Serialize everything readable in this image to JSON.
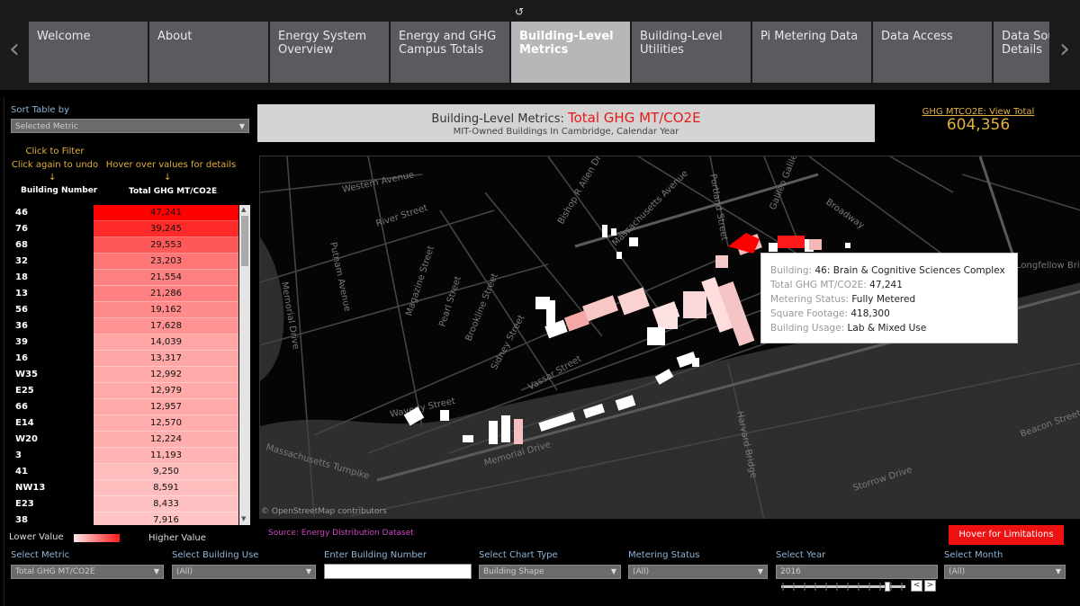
{
  "nav": {
    "tabs": [
      {
        "label": "Welcome",
        "active": false
      },
      {
        "label": "About",
        "active": false
      },
      {
        "label": "Energy System Overview",
        "active": false
      },
      {
        "label": "Energy and GHG Campus Totals",
        "active": false
      },
      {
        "label": "Building-Level Metrics",
        "active": true
      },
      {
        "label": "Building-Level Utilities",
        "active": false
      },
      {
        "label": "Pi Metering Data",
        "active": false
      },
      {
        "label": "Data Access",
        "active": false
      },
      {
        "label": "Data Source Details",
        "active": false
      }
    ],
    "reload_icon": "↺",
    "prev_icon": "‹",
    "next_icon": "›"
  },
  "sort": {
    "label": "Sort Table by",
    "value": "Selected Metric"
  },
  "hints": {
    "filter_line1": "Click to Filter",
    "filter_line2": "Click again to undo",
    "hover": "Hover over values for details",
    "arrow": "↓"
  },
  "table": {
    "col_building": "Building Number",
    "col_metric": "Total GHG MT/CO2E",
    "rows": [
      {
        "building": "46",
        "value": "47,241",
        "level": 1.0
      },
      {
        "building": "76",
        "value": "39,245",
        "level": 0.82
      },
      {
        "building": "68",
        "value": "29,553",
        "level": 0.62
      },
      {
        "building": "32",
        "value": "23,203",
        "level": 0.49
      },
      {
        "building": "18",
        "value": "21,554",
        "level": 0.45
      },
      {
        "building": "13",
        "value": "21,286",
        "level": 0.45
      },
      {
        "building": "56",
        "value": "19,162",
        "level": 0.4
      },
      {
        "building": "36",
        "value": "17,628",
        "level": 0.37
      },
      {
        "building": "39",
        "value": "14,039",
        "level": 0.29
      },
      {
        "building": "16",
        "value": "13,317",
        "level": 0.28
      },
      {
        "building": "W35",
        "value": "12,992",
        "level": 0.27
      },
      {
        "building": "E25",
        "value": "12,979",
        "level": 0.27
      },
      {
        "building": "66",
        "value": "12,957",
        "level": 0.27
      },
      {
        "building": "E14",
        "value": "12,570",
        "level": 0.26
      },
      {
        "building": "W20",
        "value": "12,224",
        "level": 0.25
      },
      {
        "building": "3",
        "value": "11,193",
        "level": 0.23
      },
      {
        "building": "41",
        "value": "9,250",
        "level": 0.19
      },
      {
        "building": "NW13",
        "value": "8,591",
        "level": 0.18
      },
      {
        "building": "E23",
        "value": "8,433",
        "level": 0.17
      },
      {
        "building": "38",
        "value": "7,916",
        "level": 0.16
      }
    ]
  },
  "legend": {
    "low": "Lower Value",
    "high": "Higher Value"
  },
  "title": {
    "prefix": "Building-Level Metrics: ",
    "metric": "Total GHG MT/CO2E",
    "subtitle": "MIT-Owned Buildings In Cambridge, Calendar Year"
  },
  "ghg_summary": {
    "link": "GHG MTCO2E: View Total",
    "total": "604,356"
  },
  "map": {
    "attribution": "© OpenStreetMap contributors",
    "streets": [
      {
        "name": "Western Avenue"
      },
      {
        "name": "River Street"
      },
      {
        "name": "Putnam Avenue"
      },
      {
        "name": "Magazine Street"
      },
      {
        "name": "Pearl Street"
      },
      {
        "name": "Brookline Street"
      },
      {
        "name": "Sidney Street"
      },
      {
        "name": "Memorial Drive"
      },
      {
        "name": "Waverly Street"
      },
      {
        "name": "Vassar Street"
      },
      {
        "name": "Massachusetts Avenue"
      },
      {
        "name": "Portland Street"
      },
      {
        "name": "Broadway"
      },
      {
        "name": "Galileo Galilei"
      },
      {
        "name": "Harvard Bridge"
      },
      {
        "name": "Storrow Drive"
      },
      {
        "name": "Beacon Street"
      },
      {
        "name": "Bishop R Allen Drive"
      },
      {
        "name": "Massachusetts Turnpike"
      },
      {
        "name": "Longfellow Bridge"
      }
    ]
  },
  "tooltip": {
    "building_label": "Building:",
    "building_value": "46:  Brain & Cognitive Sciences Complex",
    "ghg_label": "Total GHG MT/CO2E:",
    "ghg_value": "47,241",
    "metering_label": "Metering Status:",
    "metering_value": "Fully Metered",
    "sqft_label": "Square Footage:",
    "sqft_value": "418,300",
    "usage_label": "Building Usage:",
    "usage_value": "Lab & Mixed Use"
  },
  "source": "Source: Energy Distribution Dataset",
  "limitations_button": "Hover for Limitations",
  "filters": {
    "metric": {
      "label": "Select Metric",
      "value": "Total GHG MT/CO2E"
    },
    "building_use": {
      "label": "Select Building Use",
      "value": "(All)"
    },
    "building_number": {
      "label": "Enter Building Number",
      "value": ""
    },
    "chart_type": {
      "label": "Select Chart Type",
      "value": "Building Shape"
    },
    "metering": {
      "label": "Metering Status",
      "value": "(All)"
    },
    "year": {
      "label": "Select Year",
      "value": "2016"
    },
    "month": {
      "label": "Select Month",
      "value": "(All)"
    }
  },
  "colors": {
    "accent_red": "#ee1111",
    "label_blue": "#8fb4d6",
    "hint_gold": "#e1b040",
    "source_pink": "#d046c0"
  }
}
